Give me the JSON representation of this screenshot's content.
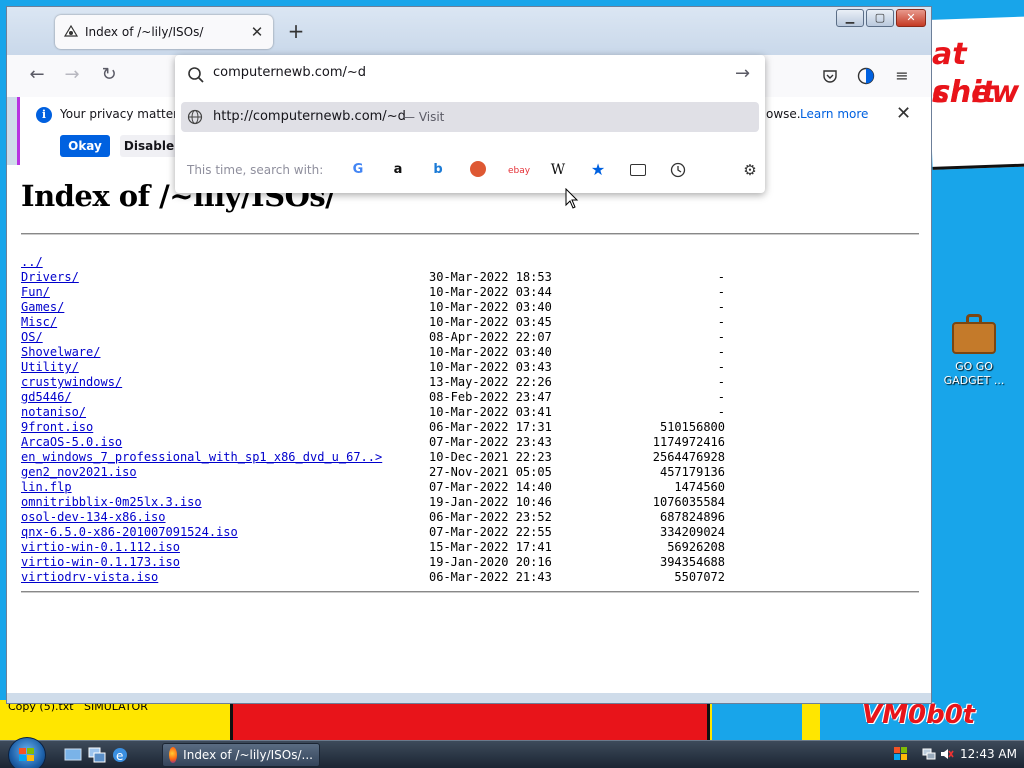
{
  "desktop": {
    "wallpaper_text_top": "at shit",
    "wallpaper_text_top2": "chew",
    "wallpaper_logo": "VM0b0t",
    "taskbar_stray_label": "Copy (5).txt",
    "taskbar_stray_label2": "SIMULATOR",
    "icon": {
      "name": "GO GO GADGET ...",
      "icon": "briefcase-icon"
    }
  },
  "browser": {
    "tab": {
      "title": "Index of /~lily/ISOs/"
    },
    "address": {
      "value": "computernewb.com/~d"
    },
    "suggestion": {
      "url": "http://computernewb.com/~d",
      "action": "— Visit"
    },
    "engines_label": "This time, search with:",
    "engines": [
      "Google",
      "Amazon",
      "Bing",
      "DuckDuckGo",
      "eBay",
      "Wikipedia",
      "Bookmarks",
      "Tabs",
      "History"
    ],
    "notification": {
      "message": "Your privacy matters. I",
      "message_tail": "owse.",
      "learn_more": "Learn more",
      "okay": "Okay",
      "disable": "Disable"
    }
  },
  "page": {
    "heading": "Index of /~lily/ISOs/",
    "entries": [
      {
        "name": "../",
        "date": "",
        "size": ""
      },
      {
        "name": "Drivers/",
        "date": "30-Mar-2022 18:53",
        "size": "-"
      },
      {
        "name": "Fun/",
        "date": "10-Mar-2022 03:44",
        "size": "-"
      },
      {
        "name": "Games/",
        "date": "10-Mar-2022 03:40",
        "size": "-"
      },
      {
        "name": "Misc/",
        "date": "10-Mar-2022 03:45",
        "size": "-"
      },
      {
        "name": "OS/",
        "date": "08-Apr-2022 22:07",
        "size": "-"
      },
      {
        "name": "Shovelware/",
        "date": "10-Mar-2022 03:40",
        "size": "-"
      },
      {
        "name": "Utility/",
        "date": "10-Mar-2022 03:43",
        "size": "-"
      },
      {
        "name": "crustywindows/",
        "date": "13-May-2022 22:26",
        "size": "-"
      },
      {
        "name": "gd5446/",
        "date": "08-Feb-2022 23:47",
        "size": "-"
      },
      {
        "name": "notaniso/",
        "date": "10-Mar-2022 03:41",
        "size": "-"
      },
      {
        "name": "9front.iso",
        "date": "06-Mar-2022 17:31",
        "size": "510156800"
      },
      {
        "name": "ArcaOS-5.0.iso",
        "date": "07-Mar-2022 23:43",
        "size": "1174972416"
      },
      {
        "name": "en_windows_7_professional_with_sp1_x86_dvd_u_67..>",
        "date": "10-Dec-2021 22:23",
        "size": "2564476928"
      },
      {
        "name": "gen2_nov2021.iso",
        "date": "27-Nov-2021 05:05",
        "size": "457179136"
      },
      {
        "name": "lin.flp",
        "date": "07-Mar-2022 14:40",
        "size": "1474560"
      },
      {
        "name": "omnitribblix-0m25lx.3.iso",
        "date": "19-Jan-2022 10:46",
        "size": "1076035584"
      },
      {
        "name": "osol-dev-134-x86.iso",
        "date": "06-Mar-2022 23:52",
        "size": "687824896"
      },
      {
        "name": "qnx-6.5.0-x86-201007091524.iso",
        "date": "07-Mar-2022 22:55",
        "size": "334209024"
      },
      {
        "name": "virtio-win-0.1.112.iso",
        "date": "15-Mar-2022 17:41",
        "size": "56926208"
      },
      {
        "name": "virtio-win-0.1.173.iso",
        "date": "19-Jan-2020 20:16",
        "size": "394354688"
      },
      {
        "name": "virtiodrv-vista.iso",
        "date": "06-Mar-2022 21:43",
        "size": "5507072"
      }
    ]
  },
  "taskbar": {
    "task_label": "Index of /~lily/ISOs/...",
    "clock": "12:43 AM"
  },
  "colors": {
    "accent": "#0061e0",
    "link": "#0000cc",
    "desktop": "#18a5ea"
  }
}
